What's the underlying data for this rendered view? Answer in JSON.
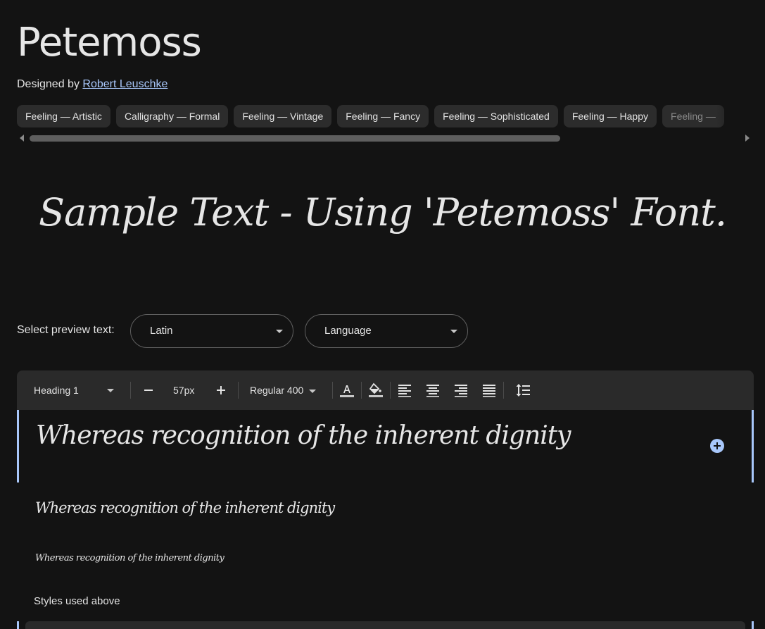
{
  "header": {
    "font_name": "Petemoss",
    "designed_by_label": "Designed by",
    "designer_name": "Robert Leuschke"
  },
  "tags": [
    "Feeling — Artistic",
    "Calligraphy — Formal",
    "Feeling — Vintage",
    "Feeling — Fancy",
    "Feeling — Sophisticated",
    "Feeling — Happy",
    "Feeling —"
  ],
  "sample": {
    "text": "Sample Text - Using 'Petemoss' Font."
  },
  "preview_controls": {
    "label": "Select preview text:",
    "script_select": "Latin",
    "language_select": "Language"
  },
  "toolbar": {
    "style_select": "Heading 1",
    "decrease_icon": "minus-icon",
    "size_value": "57px",
    "increase_icon": "plus-icon",
    "weight_select": "Regular 400",
    "icons": [
      "text-color-icon",
      "highlight-color-icon",
      "align-left-icon",
      "align-center-icon",
      "align-right-icon",
      "align-justify-icon",
      "line-height-icon"
    ]
  },
  "previews": {
    "large": "Whereas recognition of the inherent dignity",
    "medium": "Whereas recognition of the inherent dignity",
    "small": "Whereas recognition of the inherent dignity"
  },
  "styles_used_label": "Styles used above",
  "colors": {
    "background": "#131313",
    "accent": "#a8c7fa",
    "chip_bg": "#2c2c2c",
    "toolbar_bg": "#2a2a2a"
  }
}
